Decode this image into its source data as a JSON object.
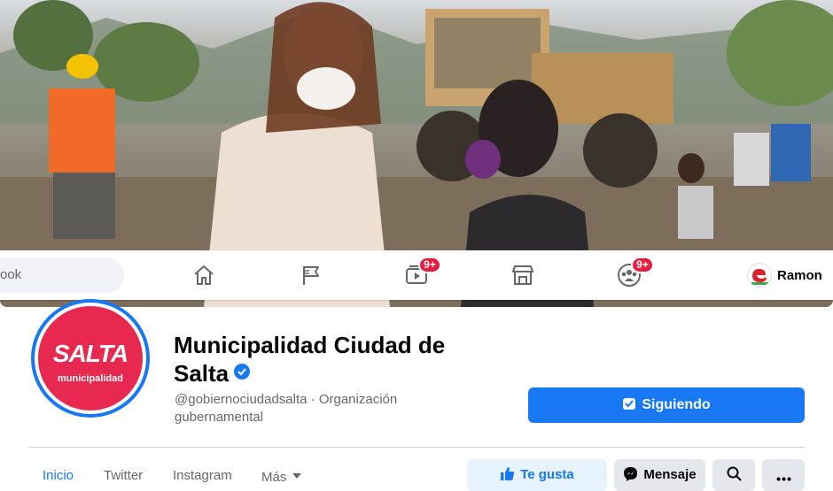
{
  "search": {
    "placeholder_fragment": "ook"
  },
  "nav": {
    "watch_badge": "9+",
    "groups_badge": "9+",
    "profile_name": "Ramon"
  },
  "page": {
    "logo_word": "SALTA",
    "logo_sub": "municipalidad",
    "title": "Municipalidad Ciudad de Salta",
    "subtitle": "@gobiernociudadsalta · Organización gubernamental",
    "follow_label": "Siguiendo"
  },
  "tabs": [
    {
      "label": "Inicio",
      "active": true
    },
    {
      "label": "Twitter"
    },
    {
      "label": "Instagram"
    },
    {
      "label": "Más"
    }
  ],
  "actions": {
    "like_label": "Te gusta",
    "message_label": "Mensaje"
  },
  "icons": {
    "nav": [
      "home-icon",
      "flag-icon",
      "watch-icon",
      "marketplace-icon",
      "groups-icon"
    ],
    "actions": [
      "thumbs-up-icon",
      "messenger-icon",
      "search-icon",
      "more-icon"
    ]
  },
  "colors": {
    "brand_blue": "#1877f2",
    "badge_red": "#e41e3f",
    "logo_pink": "#e8294f",
    "like_bg": "#e7f3ff",
    "button_grey": "#e4e6eb"
  }
}
